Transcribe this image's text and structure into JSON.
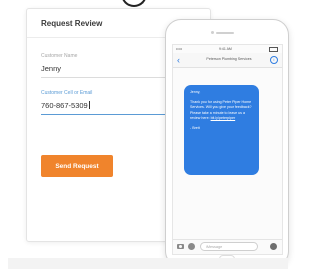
{
  "form": {
    "title": "Request Review",
    "name_label": "Customer Name",
    "name_value": "Jenny",
    "phone_label": "Customer Cell or Email",
    "phone_value": "760-867-5309",
    "submit_label": "Send Request"
  },
  "phone": {
    "status": {
      "signal": "•••••",
      "time": "9:41 AM"
    },
    "back_glyph": "‹",
    "contact": "Peterson Plumbing Services",
    "info_glyph": "i",
    "message": {
      "greeting": "Jenny,",
      "body": "Thank you for using Peter Piper Home Services. Will you give your feedback? Please take a minute to leave us a review here:",
      "link": "bit.ly/peterpiper",
      "signoff": "- Brett"
    },
    "composer_placeholder": "iMessage"
  },
  "colors": {
    "accent_orange": "#f0842c",
    "bubble_blue": "#2f7de1",
    "input_focus": "#5b9bd5"
  }
}
